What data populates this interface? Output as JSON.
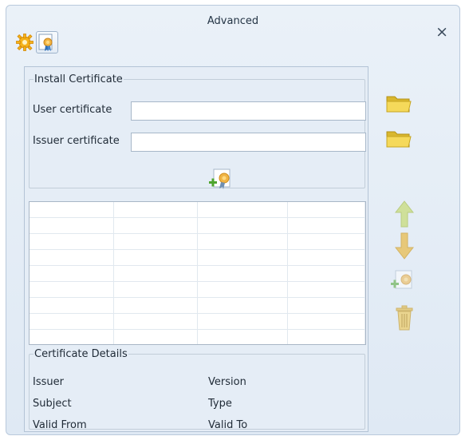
{
  "window": {
    "title": "Advanced",
    "close_label": "×"
  },
  "toolbar": {
    "icons": [
      "gear-icon",
      "certificate-icon"
    ]
  },
  "install": {
    "legend": "Install Certificate",
    "user_label": "User certificate",
    "user_value": "",
    "issuer_label": "Issuer certificate",
    "issuer_value": "",
    "browse_icon": "folder-icon",
    "install_icon": "add-certificate-icon"
  },
  "certificate_list": {
    "columns": 4,
    "rows": 9,
    "actions": [
      "move-up-icon",
      "move-down-icon",
      "add-certificate-icon",
      "trash-icon"
    ]
  },
  "details": {
    "legend": "Certificate Details",
    "issuer": "Issuer",
    "version": "Version",
    "subject": "Subject",
    "type": "Type",
    "valid_from": "Valid From",
    "valid_to": "Valid To"
  },
  "colors": {
    "window_bg": "#e4ecf5",
    "arrow_green": "#c9dc8a",
    "folder_yellow": "#f2d34e"
  }
}
